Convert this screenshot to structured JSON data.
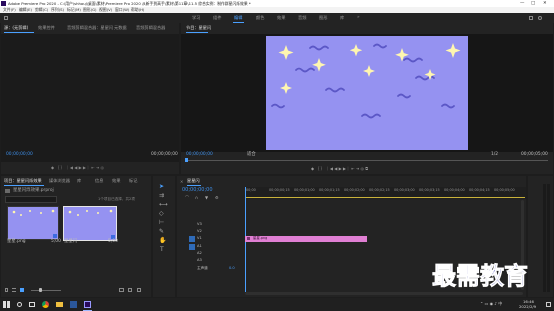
{
  "window": {
    "title": "Adobe Premiere Pro 2020 - C:\\用户\\shhouj\\桌面\\素材\\Premiere Pro 2020 从新手到高手\\素材\\第11章\\11.5 综合实例：制作群星闪烁效果 *",
    "controls": [
      "—",
      "□",
      "✕"
    ]
  },
  "menu": [
    "文件(F)",
    "编辑(E)",
    "剪辑(C)",
    "序列(S)",
    "标记(M)",
    "图形(G)",
    "视图(V)",
    "窗口(W)",
    "帮助(H)"
  ],
  "workspaces": [
    "学习",
    "组件",
    "编辑",
    "颜色",
    "效果",
    "音频",
    "图形",
    "库"
  ],
  "workspace_active": "编辑",
  "source_panel": {
    "tabs": [
      "源：(无剪辑)",
      "效果控件",
      "音频剪辑混合器：星星闪",
      "元数据",
      "音频剪辑混合器"
    ],
    "timecode_left": "00;00;00;00",
    "timecode_right": "00;00;00;00"
  },
  "program_panel": {
    "tab": "节目：星星闪",
    "timecode": "00;00;00;00",
    "fit": "适合",
    "scale": "1/2",
    "duration": "00;00;05;00"
  },
  "project_panel": {
    "tabs": [
      "项目：星星闪烁效果",
      "媒体浏览器",
      "库",
      "信息",
      "效果",
      "标记"
    ],
    "file": "星星闪烁效果.prproj",
    "count": "1个项目已选择，共2项",
    "items": [
      {
        "name": "星星.png",
        "duration": "5;00"
      },
      {
        "name": "星星闪",
        "duration": "5;00"
      }
    ]
  },
  "timeline": {
    "tab": "星星闪",
    "timecode": "00;00;00;00",
    "ruler": [
      "00;00",
      "00;00;00;15",
      "00;00;01;00",
      "00;00;01;15",
      "00;00;02;00",
      "00;00;02;15",
      "00;00;03;00",
      "00;00;03;15",
      "00;00;04;00",
      "00;00;04;15",
      "00;00;05;00"
    ],
    "tracks": [
      "V3",
      "V2",
      "V1",
      "A1",
      "A2",
      "A3",
      "主声道"
    ],
    "master_value": "0.0",
    "clip": "星星.png"
  },
  "watermark": "最需教育",
  "taskbar": {
    "time": "16:46",
    "date": "2022/2/9"
  },
  "colors": {
    "frame_bg": "#9592f1",
    "clip_pink": "#e07fd3",
    "star": "#fff6b0",
    "squiggle": "#5b57c6",
    "accent": "#3d8ee8"
  }
}
